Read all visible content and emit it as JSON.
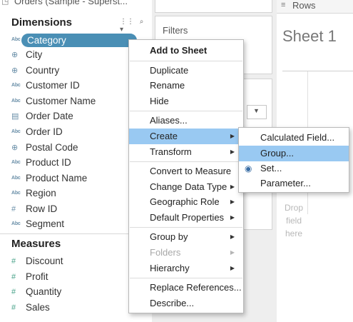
{
  "datasource": {
    "name": "Orders (Sample - Superst...",
    "icon": "datasource-icon"
  },
  "dimensions_header": "Dimensions",
  "header_tools": {
    "grid": "⋮⋮",
    "search": "⌕",
    "menu": "▾"
  },
  "dimensions": [
    {
      "icon": "Abc",
      "label": "Category",
      "selected": true
    },
    {
      "icon": "⊕",
      "label": "City"
    },
    {
      "icon": "⊕",
      "label": "Country"
    },
    {
      "icon": "Abc",
      "label": "Customer ID"
    },
    {
      "icon": "Abc",
      "label": "Customer Name"
    },
    {
      "icon": "▤",
      "label": "Order Date"
    },
    {
      "icon": "Abc",
      "label": "Order ID"
    },
    {
      "icon": "⊕",
      "label": "Postal Code"
    },
    {
      "icon": "Abc",
      "label": "Product ID"
    },
    {
      "icon": "Abc",
      "label": "Product Name"
    },
    {
      "icon": "Abc",
      "label": "Region"
    },
    {
      "icon": "#",
      "label": "Row ID"
    },
    {
      "icon": "Abc",
      "label": "Segment"
    }
  ],
  "measures_header": "Measures",
  "measures": [
    {
      "icon": "#",
      "label": "Discount"
    },
    {
      "icon": "#",
      "label": "Profit"
    },
    {
      "icon": "#",
      "label": "Quantity"
    },
    {
      "icon": "#",
      "label": "Sales"
    }
  ],
  "filters_title": "Filters",
  "rows_label": "Rows",
  "sheet_title": "Sheet 1",
  "drop_hint": [
    "Drop",
    "field",
    "here"
  ],
  "context_menu": {
    "items": [
      {
        "label": "Add to Sheet",
        "bold": true
      },
      {
        "label": "Duplicate"
      },
      {
        "label": "Rename"
      },
      {
        "label": "Hide"
      },
      {
        "label": "Aliases..."
      },
      {
        "label": "Create",
        "submenu": true,
        "highlighted": true
      },
      {
        "label": "Transform",
        "submenu": true
      },
      {
        "label": "Convert to Measure"
      },
      {
        "label": "Change Data Type",
        "submenu": true
      },
      {
        "label": "Geographic Role",
        "submenu": true
      },
      {
        "label": "Default Properties",
        "submenu": true
      },
      {
        "label": "Group by",
        "submenu": true
      },
      {
        "label": "Folders",
        "submenu": true,
        "disabled": true
      },
      {
        "label": "Hierarchy",
        "submenu": true
      },
      {
        "label": "Replace References..."
      },
      {
        "label": "Describe..."
      }
    ]
  },
  "create_submenu": {
    "items": [
      {
        "label": "Calculated Field..."
      },
      {
        "label": "Group...",
        "highlighted": true
      },
      {
        "label": "Set...",
        "icon": "set-icon"
      },
      {
        "label": "Parameter..."
      }
    ]
  },
  "colors": {
    "selected_pill": "#4a8fb5",
    "menu_highlight": "#99c9f2",
    "dimension_icon": "#6a8fa8",
    "measure_icon": "#4aa38a"
  }
}
